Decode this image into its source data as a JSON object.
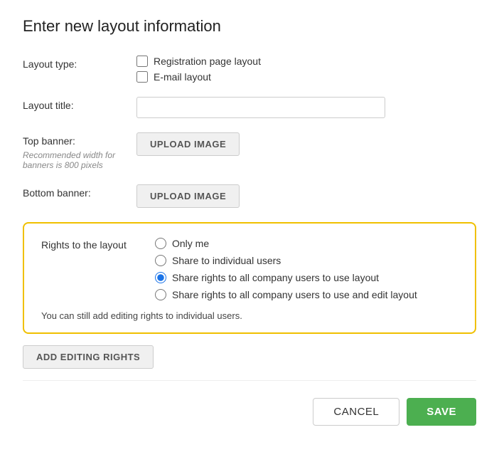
{
  "dialog": {
    "title": "Enter new layout information"
  },
  "layout_type": {
    "label": "Layout type:",
    "options": [
      {
        "id": "reg-page",
        "label": "Registration page layout",
        "checked": false
      },
      {
        "id": "email-layout",
        "label": "E-mail layout",
        "checked": false
      }
    ]
  },
  "layout_title": {
    "label": "Layout title:",
    "placeholder": "",
    "value": ""
  },
  "top_banner": {
    "label": "Top banner:",
    "note": "Recommended width for banners is 800 pixels",
    "upload_label": "UPLOAD IMAGE"
  },
  "bottom_banner": {
    "label": "Bottom banner:",
    "upload_label": "UPLOAD IMAGE"
  },
  "rights": {
    "label": "Rights to the layout",
    "options": [
      {
        "id": "only-me",
        "label": "Only me",
        "checked": false
      },
      {
        "id": "individual-users",
        "label": "Share to individual users",
        "checked": false
      },
      {
        "id": "all-company-use",
        "label": "Share rights to all company users to use layout",
        "checked": true
      },
      {
        "id": "all-company-edit",
        "label": "Share rights to all company users to use and edit layout",
        "checked": false
      }
    ],
    "note": "You can still add editing rights to individual users.",
    "add_rights_label": "ADD EDITING RIGHTS"
  },
  "footer": {
    "cancel_label": "CANCEL",
    "save_label": "SAVE"
  }
}
